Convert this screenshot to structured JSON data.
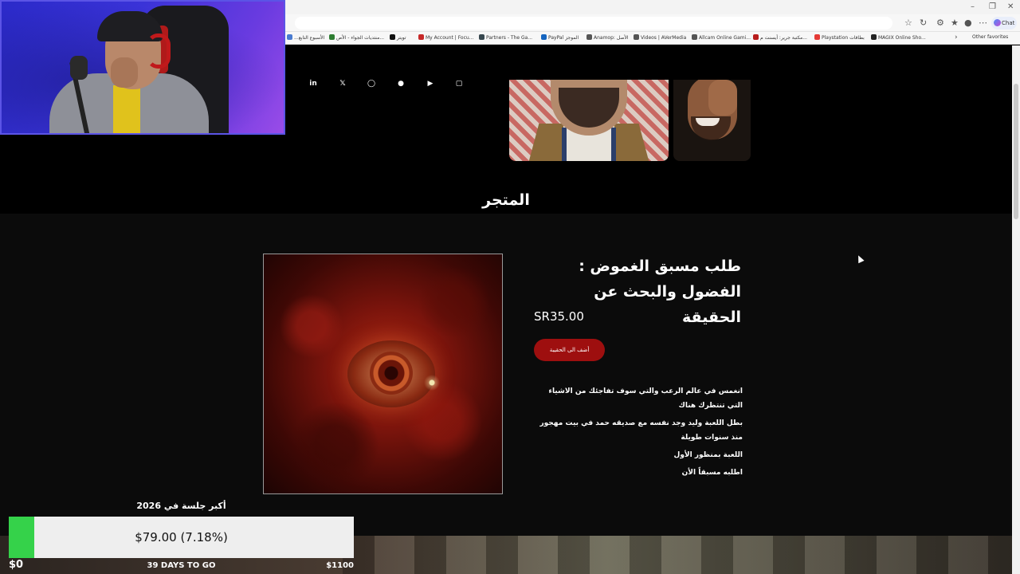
{
  "browser": {
    "bookmarks": [
      {
        "label": "...الأسبوع التابع",
        "color": "#4a7bd0"
      },
      {
        "label": "منتديات الجواء - الأص...",
        "color": "#2e7d32"
      },
      {
        "label": "تويتر",
        "color": "#111111"
      },
      {
        "label": "My Account | Focu...",
        "color": "#c62828"
      },
      {
        "label": "Partners - The Ga...",
        "color": "#37474f"
      },
      {
        "label": "PayPal الموجز",
        "color": "#1565c0"
      },
      {
        "label": "Anamop: الأصل",
        "color": "#555555"
      },
      {
        "label": "Videos | AVerMedia",
        "color": "#555555"
      },
      {
        "label": "Allcam Online Gami...",
        "color": "#555555"
      },
      {
        "label": "مكتبة جرير: أيسنت م...",
        "color": "#b71c1c"
      },
      {
        "label": "Playstation بطاقات",
        "color": "#e53935"
      },
      {
        "label": "MAGIX Online Sho...",
        "color": "#222222"
      }
    ],
    "other_favorites": "Other favorites",
    "chat_label": "Chat"
  },
  "site": {
    "social_icons": [
      "linkedin-icon",
      "x-icon",
      "instagram-icon",
      "snapchat-icon",
      "youtube-icon",
      "twitch-icon"
    ],
    "store_title": "المتجر",
    "product": {
      "title": "طلب مسبق الغموض : الفضول والبحث عن الحقيقة",
      "price": "SR35.00",
      "add_to_cart": "أضف الى الحقيبة",
      "description": [
        "انغمس في عالم الرعب والتي سوف تفاجئك من الاشياء التي تنتظرك هناك",
        "بطل اللعبة وليد وجد نفسه مع صديقه حمد في بيت مهجور منذ سنوات طويلة",
        "اللعبة بمنظور الأول",
        "اطلبه مسبقاً الأن"
      ]
    }
  },
  "stream_overlay": {
    "goal_title": "أكبر جلسة في 2026",
    "goal_amount": "$79.00 (7.18%)",
    "goal_progress": 0.0718,
    "goal_min": "$0",
    "goal_days": "39 DAYS TO GO",
    "goal_max": "$1100",
    "goal_color": "#35d24a"
  }
}
